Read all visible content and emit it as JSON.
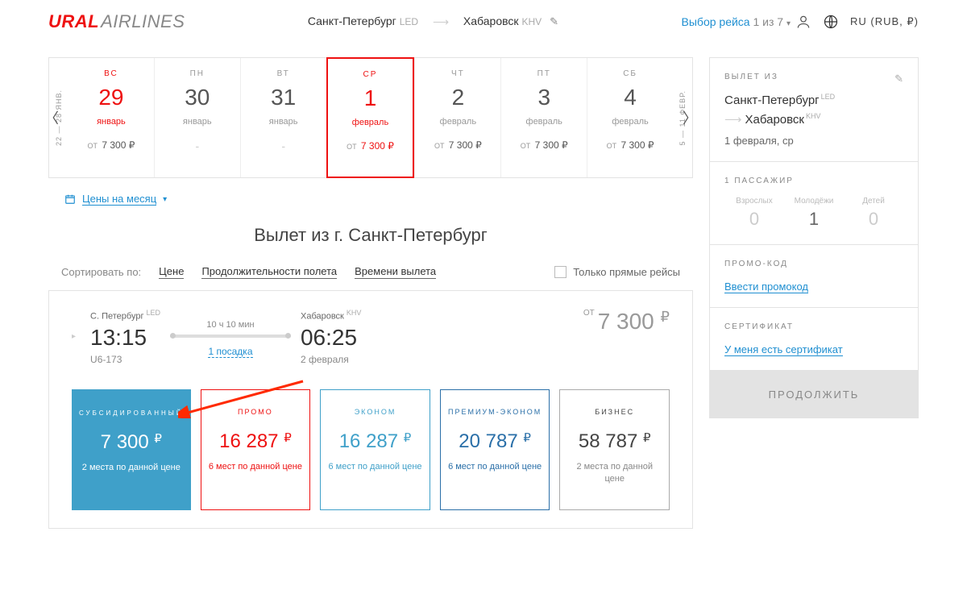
{
  "header": {
    "logo_a": "URAL",
    "logo_b": "AIRLINES",
    "from": "Санкт-Петербург",
    "from_code": "LED",
    "to": "Хабаровск",
    "to_code": "KHV",
    "step_label": "Выбор рейса",
    "step_count": "1 из 7",
    "locale": "RU (RUB, ₽)"
  },
  "dates": {
    "prev_label": "22 — 28 янв.",
    "next_label": "5 — 11 февр.",
    "cells": [
      {
        "dow": "ВС",
        "day": "29",
        "mon": "январь",
        "price": "7 300",
        "today": true
      },
      {
        "dow": "ПН",
        "day": "30",
        "mon": "январь",
        "price": null
      },
      {
        "dow": "ВТ",
        "day": "31",
        "mon": "январь",
        "price": null
      },
      {
        "dow": "СР",
        "day": "1",
        "mon": "февраль",
        "price": "7 300",
        "selected": true
      },
      {
        "dow": "ЧТ",
        "day": "2",
        "mon": "февраль",
        "price": "7 300"
      },
      {
        "dow": "ПТ",
        "day": "3",
        "mon": "февраль",
        "price": "7 300"
      },
      {
        "dow": "СБ",
        "day": "4",
        "mon": "февраль",
        "price": "7 300"
      }
    ],
    "price_prefix": "от",
    "month_link": "Цены на месяц"
  },
  "heading": "Вылет из г. Санкт-Петербург",
  "sort": {
    "label": "Сортировать по:",
    "by_price": "Цене",
    "by_duration": "Продолжительности полета",
    "by_time": "Времени вылета",
    "direct_only": "Только прямые рейсы"
  },
  "flight": {
    "dep_city": "С. Петербург",
    "dep_code": "LED",
    "dep_time": "13:15",
    "flight_no": "U6-173",
    "duration": "10 ч 10 мин",
    "stops": "1 посадка",
    "arr_city": "Хабаровск",
    "arr_code": "KHV",
    "arr_time": "06:25",
    "arr_date": "2 февраля",
    "price_prefix": "от",
    "price": "7 300"
  },
  "fares": [
    {
      "cls": "sub",
      "name": "Субсидированный",
      "price": "7 300",
      "note": "2 места по данной цене"
    },
    {
      "cls": "promo",
      "name": "Промо",
      "price": "16 287",
      "note": "6 мест по данной цене"
    },
    {
      "cls": "econ",
      "name": "Эконом",
      "price": "16 287",
      "note": "6 мест по данной цене"
    },
    {
      "cls": "prem",
      "name": "Премиум-Эконом",
      "price": "20 787",
      "note": "6 мест по данной цене"
    },
    {
      "cls": "biz",
      "name": "Бизнес",
      "price": "58 787",
      "note": "2 места по данной цене"
    }
  ],
  "sidebar": {
    "depart_title": "Вылет из",
    "from": "Санкт-Петербург",
    "from_code": "LED",
    "to": "Хабаровск",
    "to_code": "KHV",
    "date": "1 февраля, ср",
    "pax_title": "1 Пассажир",
    "pax": [
      {
        "label": "Взрослых",
        "count": "0"
      },
      {
        "label": "Молодёжи",
        "count": "1",
        "active": true
      },
      {
        "label": "Детей",
        "count": "0"
      }
    ],
    "promo_title": "Промо-код",
    "promo_link": "Ввести промокод",
    "cert_title": "Сертификат",
    "cert_link": "У меня есть сертификат",
    "continue": "Продолжить"
  },
  "ruble": "₽"
}
